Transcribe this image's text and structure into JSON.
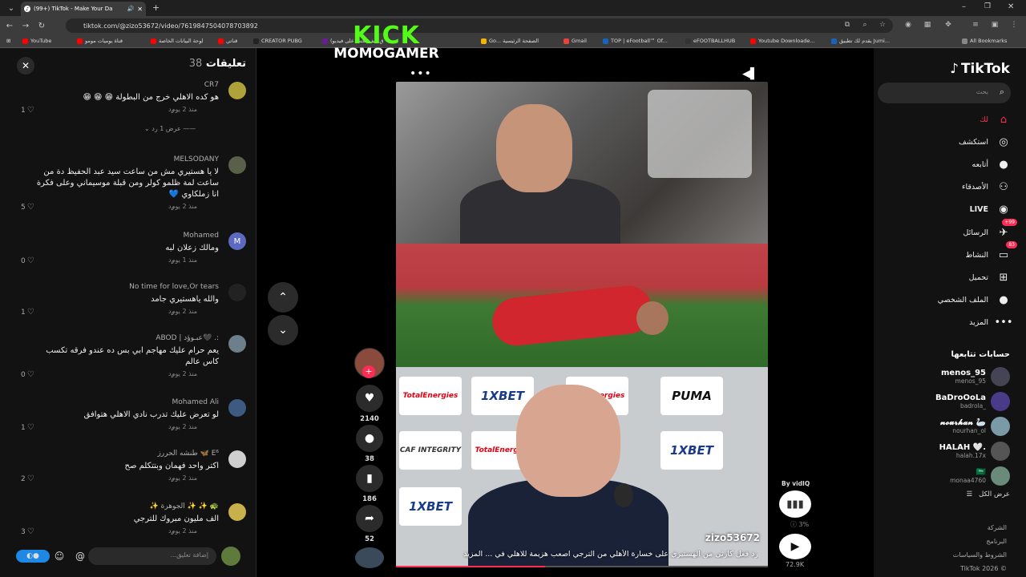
{
  "browser": {
    "tab_title": "(99+) TikTok - Make Your Da",
    "url": "tiktok.com/@zizo53672/video/7619847504078703892",
    "bookmarks": [
      {
        "label": "YouTube",
        "color": "#ff0000"
      },
      {
        "label": "قناة يوميات مومو",
        "color": "#ff0000"
      },
      {
        "label": "لوحة البيانات الخاصة",
        "color": "#ff0000"
      },
      {
        "label": "قناتي",
        "color": "#ff0000"
      },
      {
        "label": "CREATOR PUBG",
        "color": "#222222"
      },
      {
        "label": "(ق كيف تكتب على فيديو",
        "color": "#6a1b9a"
      },
      {
        "label": "Go... الصفحة الرئيسية",
        "color": "#f4b400"
      },
      {
        "label": "Gmail",
        "color": "#ea4335"
      },
      {
        "label": "TOP | eFootball™ Of...",
        "color": "#1565c0"
      },
      {
        "label": "eFOOTBALLHUB",
        "color": "#333333"
      },
      {
        "label": "Youtube Downloade...",
        "color": "#ff0000"
      },
      {
        "label": "يقدم لك تطبيق Jumi...",
        "color": "#1565c0"
      },
      {
        "label": "All Bookmarks",
        "color": "#888888"
      }
    ]
  },
  "watermark": {
    "line1": "KICK",
    "line2": "MOMOGAMER"
  },
  "comments_panel": {
    "title": "تعليقات",
    "count": "38",
    "reply_label": "رد",
    "input_placeholder": "إضافة تعليق...",
    "comments": [
      {
        "user": "CR7",
        "text": "هو كده الاهلي خرج من البطولة 😁 😁 😁",
        "time": "منذ 2 يوم",
        "likes": "1",
        "avatar_color": "#b0a23a",
        "replies_label": "عرض 1 رد"
      },
      {
        "user": "MELSODANY",
        "text": "لا يا هستيري مش من ساعت سيد عبد الحفيظ دة من ساعت لمة ظلمو كولر ومن قبلة موسيماني وعلى فكرة انا زملكاوي 💙",
        "time": "منذ 2 يوم",
        "likes": "5",
        "avatar_color": "#5a5f4a"
      },
      {
        "user": "Mohamed",
        "text": "ومالك زعلان لبه",
        "time": "منذ 1 يوم",
        "likes": "0",
        "avatar_color": "#5c6bc0",
        "avatar_letter": "M"
      },
      {
        "user": "No time for love,Or tears",
        "text": "والله ياهستيري جامد",
        "time": "منذ 2 يوم",
        "likes": "1",
        "avatar_color": "#222222"
      },
      {
        "user": "ABOD | عبـوؤد🖤 .:",
        "text": "يعم حرام عليك مهاجم ابي بس ده عندو فرقه تكسب كاس عالم",
        "time": "منذ 2 يوم",
        "likes": "0",
        "avatar_color": "#6d7f8a"
      },
      {
        "user": "Mohamed Ali",
        "text": "لو تعرض عليك تدرب نادي الاهلي هتوافق",
        "time": "منذ 2 يوم",
        "likes": "1",
        "avatar_color": "#3d5a80"
      },
      {
        "user": "طنشه الحررز 🦋 E⁶",
        "text": "اكتر واحد فهمان وبتتكلم صح",
        "time": "منذ 2 يوم",
        "likes": "2",
        "avatar_color": "#cfcfcf"
      },
      {
        "user": "✨ الجوهرة ✨ ✨ 🐢",
        "text": "الف مليون مبروك للترجي",
        "time": "منذ 2 يوم",
        "likes": "3",
        "avatar_color": "#c8b04a"
      }
    ]
  },
  "player": {
    "creator": "zizo53672",
    "caption": "رد فعل كارثي من الهستيري على خسارة الأهلي من الترجي اصعب هزيمة للاهلي في ... المزيد",
    "likes": "2140",
    "comments": "38",
    "saves": "186",
    "shares": "52",
    "sponsors": [
      "TotalEnergies",
      "1XBET",
      "TotalEnergies",
      "PUMA",
      "CAF INTEGRITY",
      "TotalEnergies",
      "1XBET",
      "1XBET"
    ],
    "progress": 0.4
  },
  "vidiq": {
    "label": "By vidIQ",
    "percent": "3%",
    "views": "72.9K"
  },
  "sidebar": {
    "logo": "TikTok",
    "search_placeholder": "بحث",
    "nav": [
      {
        "label": "لك",
        "icon": "home-icon",
        "active": true
      },
      {
        "label": "استكشف",
        "icon": "compass-icon"
      },
      {
        "label": "أتابعه",
        "icon": "following-icon"
      },
      {
        "label": "الأصدقاء",
        "icon": "friends-icon"
      },
      {
        "label": "LIVE",
        "icon": "live-icon"
      },
      {
        "label": "الرسائل",
        "icon": "messages-icon",
        "badge": "99+"
      },
      {
        "label": "النشاط",
        "icon": "activity-icon",
        "badge": "83"
      },
      {
        "label": "تحميل",
        "icon": "upload-icon"
      },
      {
        "label": "الملف الشخصي",
        "icon": "profile-icon"
      },
      {
        "label": "المزيد",
        "icon": "more-icon"
      }
    ],
    "following_title": "حسابات تتابعها",
    "following": [
      {
        "name": "menos_95",
        "handle": "menos_95",
        "color": "#445"
      },
      {
        "name": "BaDroOoLa",
        "handle": "badrola_",
        "color": "#4a3a8a"
      },
      {
        "name": "𝓷𝓸𝓾𝓻𝓱𝓪𝓷 🦢",
        "handle": "nourhan_ol",
        "color": "#7a9aa8"
      },
      {
        "name": "HALAH 🤍.",
        "handle": "halah.17x",
        "color": "#555"
      },
      {
        "name": "🇸🇦",
        "handle": "monaa4760",
        "color": "#6a8a7a"
      }
    ],
    "see_all": "عرض الكل",
    "footer": [
      "الشركة",
      "البرنامج",
      "الشروط والسياسات",
      "© 2026 TikTok"
    ]
  }
}
